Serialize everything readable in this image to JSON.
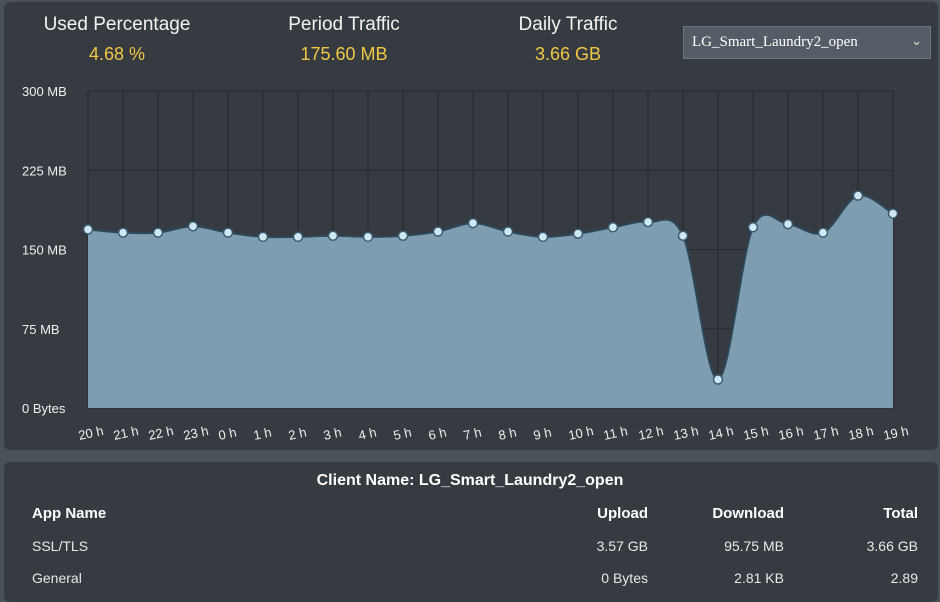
{
  "stats": [
    {
      "label": "Used Percentage",
      "value": "4.68 %"
    },
    {
      "label": "Period Traffic",
      "value": "175.60 MB"
    },
    {
      "label": "Daily Traffic",
      "value": "3.66 GB"
    }
  ],
  "client_select": {
    "value": "LG_Smart_Laundry2_open",
    "icon": "chevron-down-icon"
  },
  "chart_data": {
    "type": "area",
    "categories": [
      "20 h",
      "21 h",
      "22 h",
      "23 h",
      "0 h",
      "1 h",
      "2 h",
      "3 h",
      "4 h",
      "5 h",
      "6 h",
      "7 h",
      "8 h",
      "9 h",
      "10 h",
      "11 h",
      "12 h",
      "13 h",
      "14 h",
      "15 h",
      "16 h",
      "17 h",
      "18 h",
      "19 h"
    ],
    "values": [
      169,
      166,
      166,
      172,
      166,
      162,
      162,
      163,
      162,
      163,
      167,
      175,
      167,
      162,
      165,
      171,
      176,
      163,
      27,
      171,
      174,
      166,
      201,
      184
    ],
    "unit": "MB",
    "ylim": [
      0,
      300
    ],
    "yticks": [
      "0 Bytes",
      "75 MB",
      "150 MB",
      "225 MB",
      "300 MB"
    ],
    "grid": true,
    "colors": {
      "fill": "#7f9db0",
      "line": "#2e4758",
      "point": "#cfe8f6"
    }
  },
  "table": {
    "title": "Client Name: LG_Smart_Laundry2_open",
    "headers": [
      "App Name",
      "Upload",
      "Download",
      "Total"
    ],
    "rows": [
      [
        "SSL/TLS",
        "3.57 GB",
        "95.75 MB",
        "3.66 GB"
      ],
      [
        "General",
        "0 Bytes",
        "2.81 KB",
        "2.89"
      ]
    ]
  }
}
